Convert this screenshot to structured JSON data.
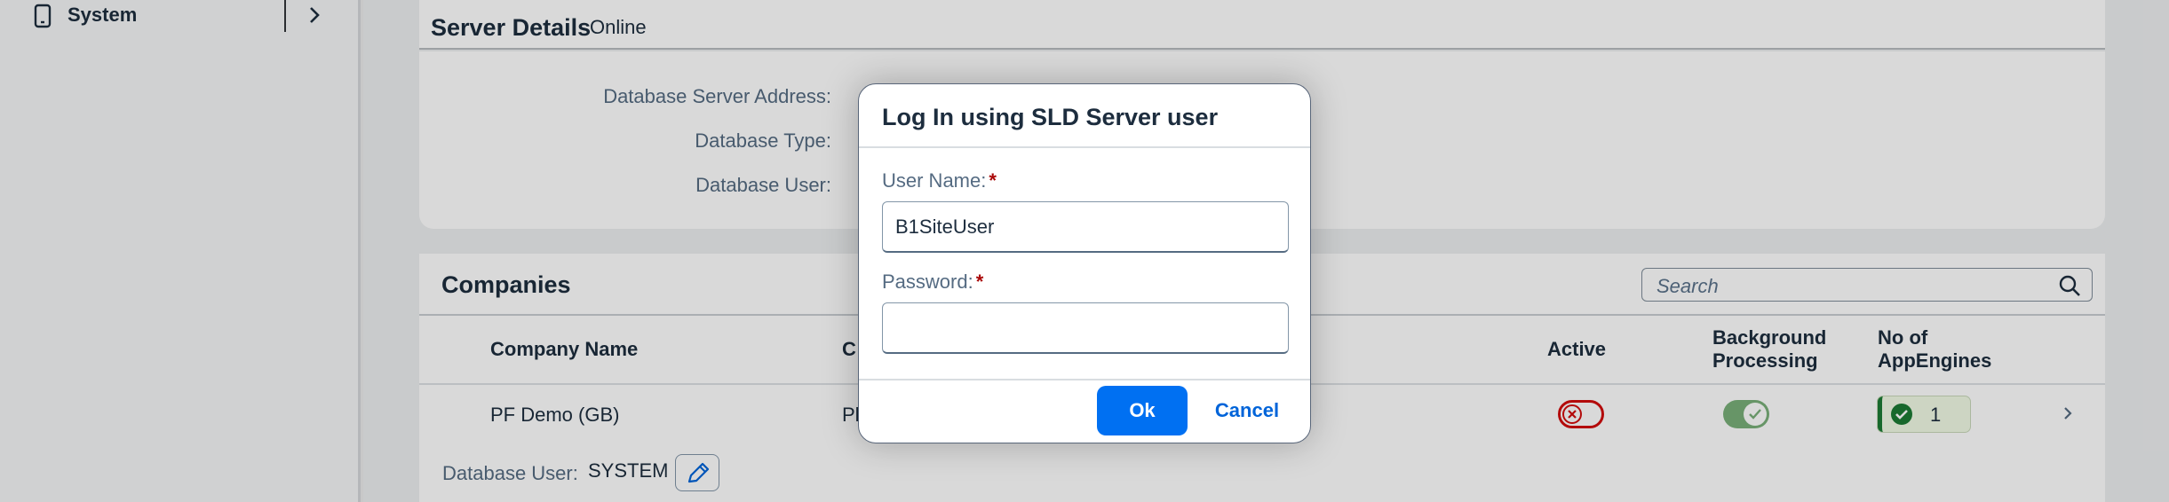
{
  "sidebar": {
    "items": [
      {
        "label": "System",
        "icon": "mobile-device-icon"
      }
    ]
  },
  "server": {
    "title": "Server Details",
    "status": "Online",
    "fields": [
      {
        "label": "Database Server Address:"
      },
      {
        "label": "Database Type:"
      },
      {
        "label": "Database User:"
      }
    ]
  },
  "companies": {
    "title": "Companies",
    "search_placeholder": "Search",
    "columns": {
      "company_name": "Company Name",
      "second": "C",
      "active": "Active",
      "background_processing": "Background Processing",
      "no_of_appengines": "No of AppEngines"
    },
    "rows": [
      {
        "company_name": "PF Demo (GB)",
        "second": "Pl",
        "active": false,
        "background_processing": true,
        "appengines": "1"
      }
    ],
    "database_user_label": "Database User:",
    "database_user_value": "SYSTEM"
  },
  "dialog": {
    "title": "Log In using SLD Server user",
    "username_label": "User Name:",
    "username_value": "B1SiteUser",
    "password_label": "Password:",
    "password_value": "",
    "required_marker": "*",
    "ok_label": "Ok",
    "cancel_label": "Cancel"
  },
  "colors": {
    "accent": "#0070f2",
    "error": "#d30d0d",
    "success": "#1c7b34"
  }
}
